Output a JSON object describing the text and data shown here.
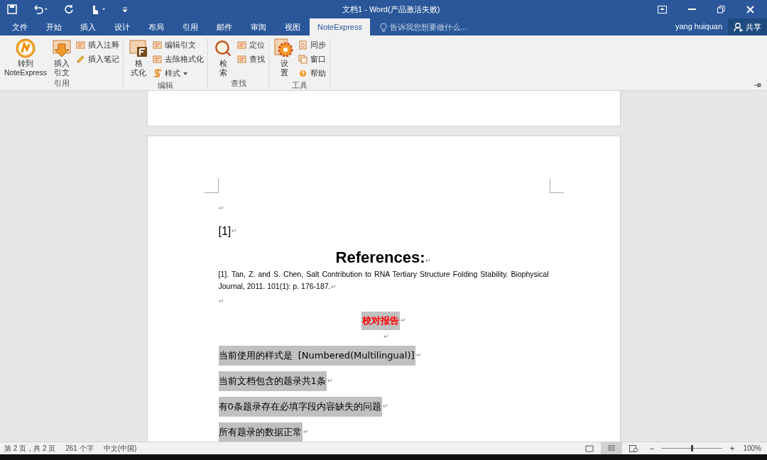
{
  "window": {
    "title": "文档1 - Word(产品激活失败)"
  },
  "tabs": [
    {
      "label": "文件",
      "selected": false
    },
    {
      "label": "开始",
      "selected": false
    },
    {
      "label": "插入",
      "selected": false
    },
    {
      "label": "设计",
      "selected": false
    },
    {
      "label": "布局",
      "selected": false
    },
    {
      "label": "引用",
      "selected": false
    },
    {
      "label": "邮件",
      "selected": false
    },
    {
      "label": "审阅",
      "selected": false
    },
    {
      "label": "视图",
      "selected": false
    },
    {
      "label": "NoteExpress",
      "selected": true
    }
  ],
  "tell_me": {
    "placeholder": "告诉我您想要做什么..."
  },
  "user": "yang huiquan",
  "share": "共享",
  "ribbon_groups": [
    {
      "label": "引用",
      "large": [
        {
          "lines": [
            "转到",
            "NoteExpress"
          ]
        },
        {
          "lines": [
            "插入",
            "引文"
          ]
        }
      ],
      "small": [
        {
          "label": "插入注释"
        },
        {
          "label": "插入笔记"
        }
      ]
    },
    {
      "label": "编辑",
      "large": [
        {
          "lines": [
            "格",
            "式化"
          ]
        }
      ],
      "small": [
        {
          "label": "编辑引文"
        },
        {
          "label": "去除格式化"
        },
        {
          "label": "样式",
          "dropdown": true
        }
      ]
    },
    {
      "label": "查找",
      "large": [
        {
          "lines": [
            "检",
            "索"
          ]
        }
      ],
      "small": [
        {
          "label": "定位"
        },
        {
          "label": "查找"
        }
      ]
    },
    {
      "label": "工具",
      "large": [
        {
          "lines": [
            "设",
            "置"
          ]
        }
      ],
      "small": [
        {
          "label": "同步"
        },
        {
          "label": "窗口"
        },
        {
          "label": "帮助"
        }
      ]
    }
  ],
  "document": {
    "paragraphs": [
      {
        "kind": "empty",
        "mark": "↵"
      },
      {
        "kind": "citation",
        "text": "[1]",
        "mark": "↵"
      },
      {
        "kind": "heading",
        "text": "References:",
        "mark": "↵"
      },
      {
        "kind": "reference",
        "text": "[1].  Tan, Z. and S. Chen, Salt Contribution to RNA Tertiary Structure Folding Stability. Biophysical Journal, 2011. 101(1): p. 176-187.",
        "mark": "↵"
      },
      {
        "kind": "empty",
        "mark": "↵"
      },
      {
        "kind": "report_title",
        "text": "校对报告",
        "mark": "↵"
      },
      {
        "kind": "empty_center",
        "mark": "↵"
      },
      {
        "kind": "report_line",
        "text": "当前使用的样式是  [Numbered(Multilingual)]",
        "mark": "↵"
      },
      {
        "kind": "report_line",
        "text": "当前文档包含的题录共1条",
        "mark": "↵"
      },
      {
        "kind": "report_line",
        "text": "有0条题录存在必填字段内容缺失的问题",
        "mark": "↵"
      },
      {
        "kind": "report_line",
        "text": "所有题录的数据正常",
        "mark": "↵"
      }
    ]
  },
  "status_bar": {
    "page": "第 2 页，共 2 页",
    "words": "261 个字",
    "language": "中文(中国)",
    "zoom_out": "−",
    "zoom_slider": {
      "level": 0.5
    },
    "zoom_in": "+",
    "zoom": "100%"
  }
}
